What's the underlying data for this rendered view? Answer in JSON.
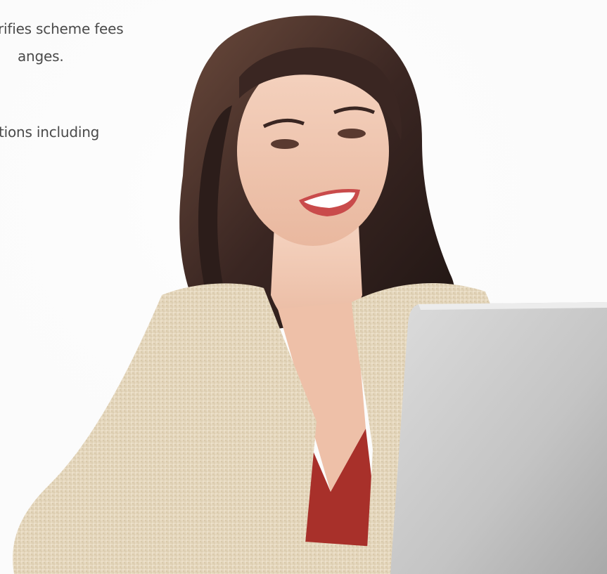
{
  "hero": {
    "image": {
      "subject": "smiling-woman-with-laptop-photo",
      "colors": {
        "background": "#fbfbfb",
        "hair": "#3a2622",
        "skin": "#f0c7b2",
        "cardigan": "#e6d8bf",
        "top": "#a8302a",
        "laptop": "#c9c9c9"
      }
    },
    "text_lines": [
      "rifies scheme fees",
      "anges.",
      "tions including"
    ]
  }
}
